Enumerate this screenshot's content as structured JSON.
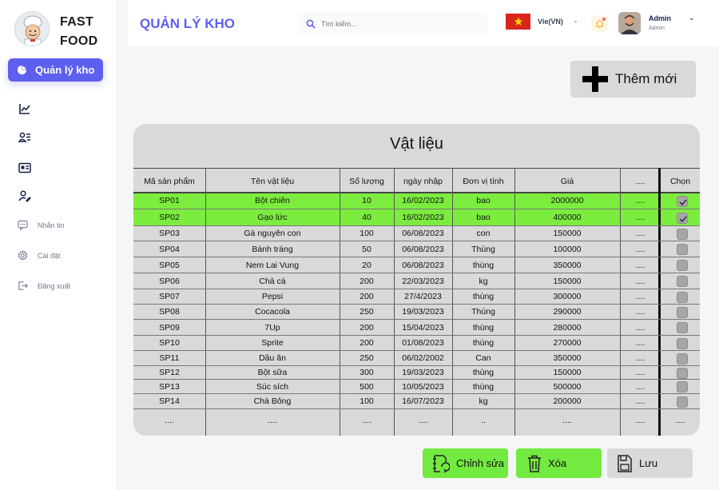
{
  "brand": {
    "line1": "FAST",
    "line2": "FOOD"
  },
  "sidebar": {
    "active_label": "Quản lý kho",
    "items": [
      {
        "icon": "chart-line-icon"
      },
      {
        "icon": "user-list-icon"
      },
      {
        "icon": "id-card-icon"
      },
      {
        "icon": "user-edit-icon"
      },
      {
        "icon": "message-icon",
        "label": "Nhắn tin"
      },
      {
        "icon": "settings-icon",
        "label": "Cài đặt"
      },
      {
        "icon": "logout-icon",
        "label": "Đăng xuất"
      }
    ]
  },
  "header": {
    "title": "QUẢN LÝ KHO",
    "search_placeholder": "Tìm kiếm...",
    "language": "Vie(VN)",
    "user_name": "Admin",
    "user_role": "Admin"
  },
  "add_button_label": "Thêm mới",
  "table": {
    "title": "Vật liệu",
    "columns": [
      "Mã sản phẩm",
      "Tên vật liệu",
      "Số lượng",
      "ngày nhập",
      "Đơn vị tính",
      "Giá",
      "....",
      "Chọn"
    ],
    "rows": [
      {
        "code": "SP01",
        "name": "Bột chiên",
        "qty": "10",
        "date": "16/02/2023",
        "unit": "bao",
        "price": "2000000",
        "more": "....",
        "selected": true
      },
      {
        "code": "SP02",
        "name": "Gạo lức",
        "qty": "40",
        "date": "16/02/2023",
        "unit": "bao",
        "price": "400000",
        "more": "....",
        "selected": true
      },
      {
        "code": "SP03",
        "name": "Gà nguyên con",
        "qty": "100",
        "date": "06/08/2023",
        "unit": "con",
        "price": "150000",
        "more": "....",
        "selected": false
      },
      {
        "code": "SP04",
        "name": "Bánh tráng",
        "qty": "50",
        "date": "06/08/2023",
        "unit": "Thùng",
        "price": "100000",
        "more": "....",
        "selected": false
      },
      {
        "code": "SP05",
        "name": "Nem Lai Vung",
        "qty": "20",
        "date": "06/08/2023",
        "unit": "thùng",
        "price": "350000",
        "more": "....",
        "selected": false
      },
      {
        "code": "SP06",
        "name": "Chả cá",
        "qty": "200",
        "date": "22/03/2023",
        "unit": "kg",
        "price": "150000",
        "more": "....",
        "selected": false
      },
      {
        "code": "SP07",
        "name": "Pepsi",
        "qty": "200",
        "date": "27/4/2023",
        "unit": "thùng",
        "price": "300000",
        "more": "....",
        "selected": false
      },
      {
        "code": "SP08",
        "name": "Cocacola",
        "qty": "250",
        "date": "19/03/2023",
        "unit": "Thùng",
        "price": "290000",
        "more": "....",
        "selected": false
      },
      {
        "code": "SP09",
        "name": "7Up",
        "qty": "200",
        "date": "15/04/2023",
        "unit": "thùng",
        "price": "280000",
        "more": "....",
        "selected": false
      },
      {
        "code": "SP10",
        "name": "Sprite",
        "qty": "200",
        "date": "01/08/2023",
        "unit": "thùng",
        "price": "270000",
        "more": "....",
        "selected": false
      },
      {
        "code": "SP11",
        "name": "Dầu ăn",
        "qty": "250",
        "date": "06/02/2002",
        "unit": "Can",
        "price": "350000",
        "more": "....",
        "selected": false
      },
      {
        "code": "SP12",
        "name": "Bột sữa",
        "qty": "300",
        "date": "19/03/2023",
        "unit": "thùng",
        "price": "150000",
        "more": "....",
        "selected": false
      },
      {
        "code": "SP13",
        "name": "Súc sích",
        "qty": "500",
        "date": "10/05/2023",
        "unit": "thùng",
        "price": "500000",
        "more": "....",
        "selected": false
      },
      {
        "code": "SP14",
        "name": "Chà Bông",
        "qty": "100",
        "date": "16/07/2023",
        "unit": "kg",
        "price": "200000",
        "more": "....",
        "selected": false
      },
      {
        "code": "....",
        "name": "....",
        "qty": "....",
        "date": "....",
        "unit": "..",
        "price": "....",
        "more": "....",
        "selected": null,
        "choose": "...."
      }
    ]
  },
  "actions": {
    "edit_label": "Chỉnh sửa",
    "delete_label": "Xóa",
    "save_label": "Lưu"
  },
  "colors": {
    "accent": "#5d5fef",
    "selected_row": "#7ced3f",
    "action_green": "#72ea3f",
    "card": "#d9d9d9"
  }
}
